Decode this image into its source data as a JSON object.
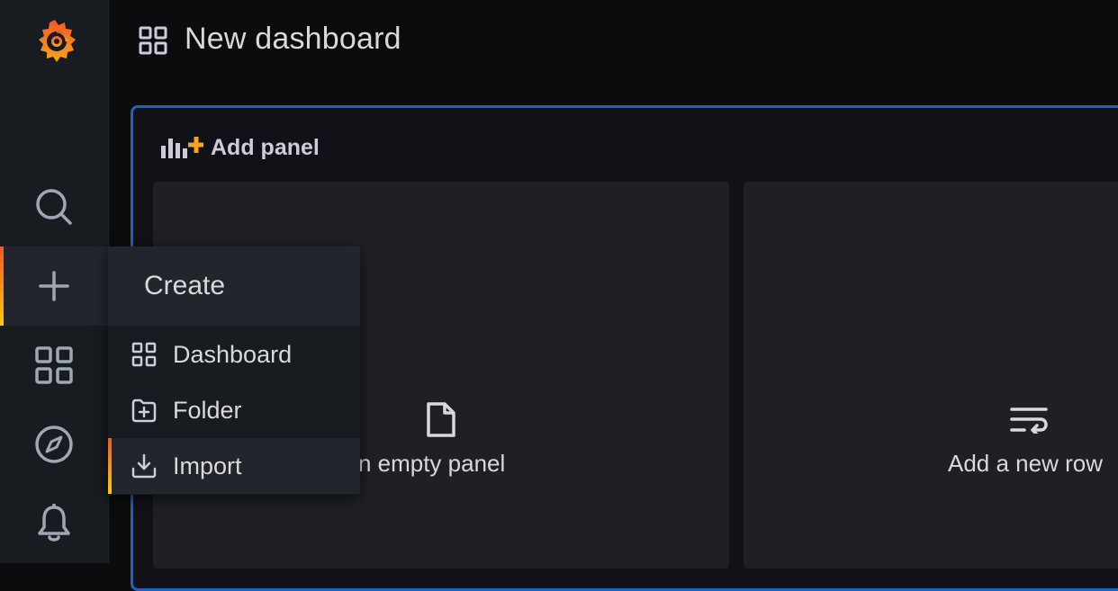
{
  "topbar": {
    "title": "New dashboard"
  },
  "panel": {
    "header": "Add panel",
    "empty_panel_label": "Add an empty panel",
    "new_row_label": "Add a new row"
  },
  "sidebar": {
    "items": [
      {
        "icon": "search-icon"
      },
      {
        "icon": "plus-icon",
        "active": true
      },
      {
        "icon": "apps-icon"
      },
      {
        "icon": "compass-icon"
      },
      {
        "icon": "bell-icon"
      }
    ]
  },
  "create_menu": {
    "title": "Create",
    "items": [
      {
        "label": "Dashboard",
        "icon": "apps-icon"
      },
      {
        "label": "Folder",
        "icon": "folder-plus-icon"
      },
      {
        "label": "Import",
        "icon": "import-icon",
        "active": true
      }
    ]
  },
  "colors": {
    "accent_blue": "#1f60c4",
    "accent_orange": "#f05a28",
    "accent_yellow": "#fbca0a",
    "background": "#0b0c0e",
    "sidebar": "#181b1f"
  }
}
